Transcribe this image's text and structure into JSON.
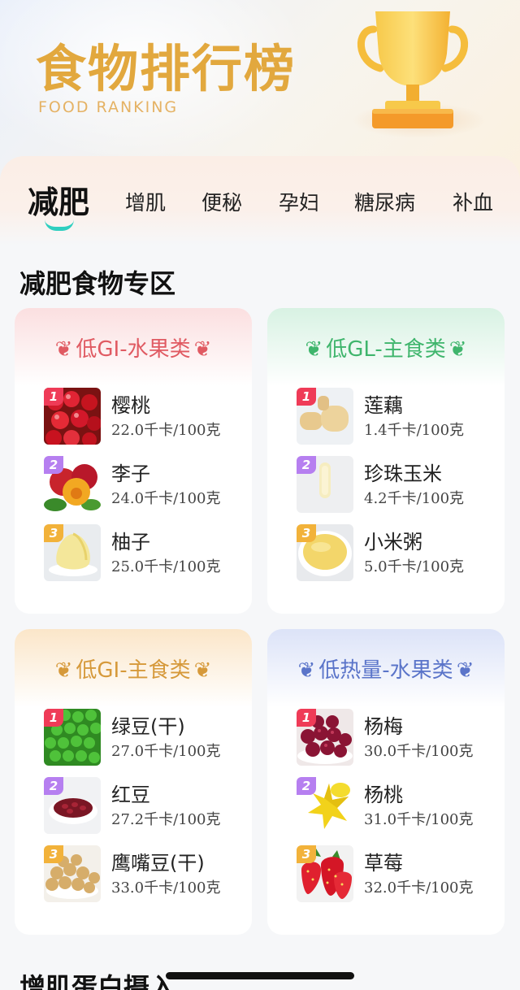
{
  "header": {
    "title": "食物排行榜",
    "subtitle": "FOOD RANKING"
  },
  "tabs": [
    {
      "label": "减肥",
      "active": true
    },
    {
      "label": "增肌",
      "active": false
    },
    {
      "label": "便秘",
      "active": false
    },
    {
      "label": "孕妇",
      "active": false
    },
    {
      "label": "糖尿病",
      "active": false
    },
    {
      "label": "补血",
      "active": false
    }
  ],
  "sections": [
    {
      "title": "减肥食物专区"
    },
    {
      "title": "增肌蛋白摄入"
    }
  ],
  "cards": [
    {
      "title": "低GI-水果类",
      "color": "#e05a62",
      "head_bg": "#fbe1e2",
      "items": [
        {
          "rank": "1",
          "name": "樱桃",
          "kcal": "22.0千卡/100克",
          "icon": "cherry-icon"
        },
        {
          "rank": "2",
          "name": "李子",
          "kcal": "24.0千卡/100克",
          "icon": "plum-icon"
        },
        {
          "rank": "3",
          "name": "柚子",
          "kcal": "25.0千卡/100克",
          "icon": "pomelo-icon"
        }
      ]
    },
    {
      "title": "低GL-主食类",
      "color": "#3fb56c",
      "head_bg": "#dcf3e6",
      "items": [
        {
          "rank": "1",
          "name": "莲藕",
          "kcal": "1.4千卡/100克",
          "icon": "lotus-root-icon"
        },
        {
          "rank": "2",
          "name": "珍珠玉米",
          "kcal": "4.2千卡/100克",
          "icon": "corn-icon"
        },
        {
          "rank": "3",
          "name": "小米粥",
          "kcal": "5.0千卡/100克",
          "icon": "millet-porridge-icon"
        }
      ]
    },
    {
      "title": "低GI-主食类",
      "color": "#d6993a",
      "head_bg": "#fcecd5",
      "items": [
        {
          "rank": "1",
          "name": "绿豆(干)",
          "kcal": "27.0千卡/100克",
          "icon": "mung-bean-icon"
        },
        {
          "rank": "2",
          "name": "红豆",
          "kcal": "27.2千卡/100克",
          "icon": "red-bean-icon"
        },
        {
          "rank": "3",
          "name": "鹰嘴豆(干)",
          "kcal": "33.0千卡/100克",
          "icon": "chickpea-icon"
        }
      ]
    },
    {
      "title": "低热量-水果类",
      "color": "#5a74c9",
      "head_bg": "#dfe6f8",
      "items": [
        {
          "rank": "1",
          "name": "杨梅",
          "kcal": "30.0千卡/100克",
          "icon": "bayberry-icon"
        },
        {
          "rank": "2",
          "name": "杨桃",
          "kcal": "31.0千卡/100克",
          "icon": "starfruit-icon"
        },
        {
          "rank": "3",
          "name": "草莓",
          "kcal": "32.0千卡/100克",
          "icon": "strawberry-icon"
        }
      ]
    }
  ]
}
